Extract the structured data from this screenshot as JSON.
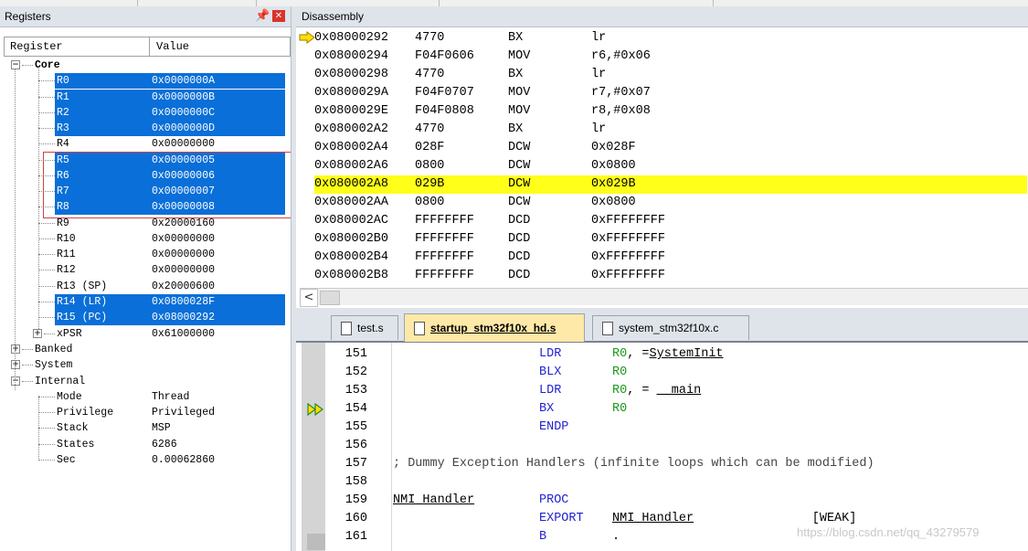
{
  "registers_panel": {
    "title": "Registers",
    "col_register": "Register",
    "col_value": "Value",
    "rows": [
      {
        "name": "Core",
        "value": "",
        "kind": "group-open",
        "level": 0,
        "bold": true
      },
      {
        "name": "R0",
        "value": "0x0000000A",
        "selected": true,
        "level": 2
      },
      {
        "name": "R1",
        "value": "0x0000000B",
        "selected": true,
        "level": 2
      },
      {
        "name": "R2",
        "value": "0x0000000C",
        "selected": true,
        "level": 2
      },
      {
        "name": "R3",
        "value": "0x0000000D",
        "selected": true,
        "level": 2
      },
      {
        "name": "R4",
        "value": "0x00000000",
        "selected": false,
        "level": 2
      },
      {
        "name": "R5",
        "value": "0x00000005",
        "selected": true,
        "level": 2
      },
      {
        "name": "R6",
        "value": "0x00000006",
        "selected": true,
        "level": 2
      },
      {
        "name": "R7",
        "value": "0x00000007",
        "selected": true,
        "level": 2
      },
      {
        "name": "R8",
        "value": "0x00000008",
        "selected": true,
        "level": 2
      },
      {
        "name": "R9",
        "value": "0x20000160",
        "selected": false,
        "level": 2
      },
      {
        "name": "R10",
        "value": "0x00000000",
        "selected": false,
        "level": 2
      },
      {
        "name": "R11",
        "value": "0x00000000",
        "selected": false,
        "level": 2
      },
      {
        "name": "R12",
        "value": "0x00000000",
        "selected": false,
        "level": 2
      },
      {
        "name": "R13 (SP)",
        "value": "0x20000600",
        "selected": false,
        "level": 2
      },
      {
        "name": "R14 (LR)",
        "value": "0x0800028F",
        "selected": true,
        "level": 2
      },
      {
        "name": "R15 (PC)",
        "value": "0x08000292",
        "selected": true,
        "level": 2
      },
      {
        "name": "xPSR",
        "value": "0x61000000",
        "kind": "group-closed",
        "level": 1
      },
      {
        "name": "Banked",
        "value": "",
        "kind": "group-closed",
        "level": 0
      },
      {
        "name": "System",
        "value": "",
        "kind": "group-closed",
        "level": 0
      },
      {
        "name": "Internal",
        "value": "",
        "kind": "group-open",
        "level": 0
      },
      {
        "name": "Mode",
        "value": "Thread",
        "level": 1
      },
      {
        "name": "Privilege",
        "value": "Privileged",
        "level": 1
      },
      {
        "name": "Stack",
        "value": "MSP",
        "level": 1
      },
      {
        "name": "States",
        "value": "6286",
        "level": 1
      },
      {
        "name": "Sec",
        "value": "0.00062860",
        "level": 1
      }
    ]
  },
  "disassembly_panel": {
    "title": "Disassembly",
    "rows": [
      {
        "addr": "0x08000292",
        "opcode": "4770",
        "mnemonic": "BX",
        "operand": "lr",
        "current": true
      },
      {
        "addr": "0x08000294",
        "opcode": "F04F0606",
        "mnemonic": "MOV",
        "operand": "r6,#0x06"
      },
      {
        "addr": "0x08000298",
        "opcode": "4770",
        "mnemonic": "BX",
        "operand": "lr"
      },
      {
        "addr": "0x0800029A",
        "opcode": "F04F0707",
        "mnemonic": "MOV",
        "operand": "r7,#0x07"
      },
      {
        "addr": "0x0800029E",
        "opcode": "F04F0808",
        "mnemonic": "MOV",
        "operand": "r8,#0x08"
      },
      {
        "addr": "0x080002A2",
        "opcode": "4770",
        "mnemonic": "BX",
        "operand": "lr"
      },
      {
        "addr": "0x080002A4",
        "opcode": "028F",
        "mnemonic": "DCW",
        "operand": "0x028F"
      },
      {
        "addr": "0x080002A6",
        "opcode": "0800",
        "mnemonic": "DCW",
        "operand": "0x0800"
      },
      {
        "addr": "0x080002A8",
        "opcode": "029B",
        "mnemonic": "DCW",
        "operand": "0x029B",
        "highlight": true
      },
      {
        "addr": "0x080002AA",
        "opcode": "0800",
        "mnemonic": "DCW",
        "operand": "0x0800"
      },
      {
        "addr": "0x080002AC",
        "opcode": "FFFFFFFF",
        "mnemonic": "DCD",
        "operand": "0xFFFFFFFF"
      },
      {
        "addr": "0x080002B0",
        "opcode": "FFFFFFFF",
        "mnemonic": "DCD",
        "operand": "0xFFFFFFFF"
      },
      {
        "addr": "0x080002B4",
        "opcode": "FFFFFFFF",
        "mnemonic": "DCD",
        "operand": "0xFFFFFFFF"
      },
      {
        "addr": "0x080002B8",
        "opcode": "FFFFFFFF",
        "mnemonic": "DCD",
        "operand": "0xFFFFFFFF"
      }
    ],
    "scroll_left": "<"
  },
  "editor": {
    "tabs": [
      {
        "label": "test.s",
        "active": false
      },
      {
        "label": "startup_stm32f10x_hd.s",
        "active": true
      },
      {
        "label": "system_stm32f10x.c",
        "active": false
      }
    ],
    "lines": [
      {
        "no": "151",
        "label": "",
        "op": "LDR",
        "args": [
          {
            "t": "R0",
            "c": "reg"
          },
          {
            "t": ", =",
            "c": ""
          },
          {
            "t": "SystemInit",
            "c": "u"
          }
        ]
      },
      {
        "no": "152",
        "label": "",
        "op": "BLX",
        "args": [
          {
            "t": "R0",
            "c": "reg"
          }
        ]
      },
      {
        "no": "153",
        "label": "",
        "op": "LDR",
        "args": [
          {
            "t": "R0",
            "c": "reg"
          },
          {
            "t": ", = ",
            "c": ""
          },
          {
            "t": "__main",
            "c": "u"
          }
        ]
      },
      {
        "no": "154",
        "label": "",
        "op": "BX",
        "args": [
          {
            "t": "R0",
            "c": "reg"
          }
        ]
      },
      {
        "no": "155",
        "label": "",
        "op": "ENDP",
        "args": []
      },
      {
        "no": "156",
        "label": "",
        "op": "",
        "args": []
      },
      {
        "no": "157",
        "comment": "; Dummy Exception Handlers (infinite loops which can be modified)"
      },
      {
        "no": "158",
        "label": "",
        "op": "",
        "args": []
      },
      {
        "no": "159",
        "label": "NMI_Handler",
        "op": "PROC",
        "args": []
      },
      {
        "no": "160",
        "label": "",
        "op": "EXPORT",
        "args": [
          {
            "t": "NMI_Handler",
            "c": "u"
          },
          {
            "t": "                [WEAK]",
            "c": ""
          }
        ]
      },
      {
        "no": "161",
        "label": "",
        "op": "B",
        "args": [
          {
            "t": ".",
            "c": ""
          }
        ]
      }
    ]
  },
  "watermark": "https://blog.csdn.net/qq_43279579",
  "colors": {
    "selection": "#0a6fd8",
    "highlight_line": "#ffff1a",
    "keyword": "#1f1fd1",
    "register": "#1a9b1a"
  },
  "icons": {
    "pin": "pin-icon",
    "close": "close-icon",
    "pc_arrow": "pc-arrow-icon",
    "exec_arrow": "double-arrow-icon"
  }
}
